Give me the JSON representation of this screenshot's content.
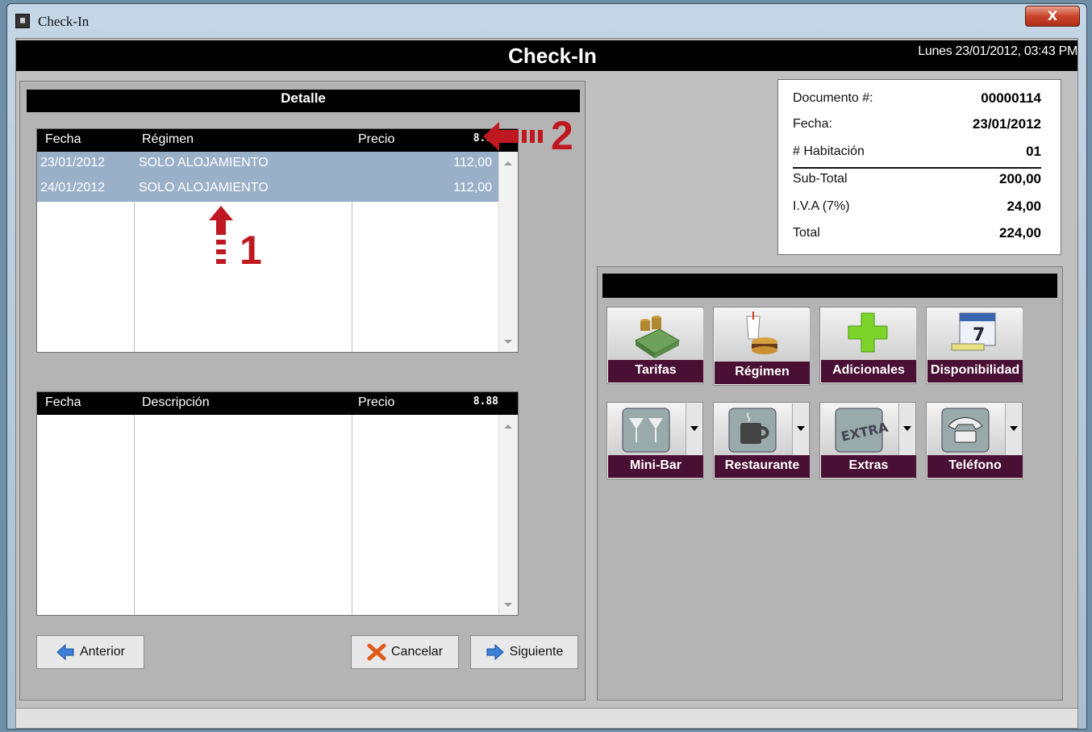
{
  "window": {
    "title": "Check-In",
    "close_label": "X"
  },
  "header": {
    "title": "Check-In",
    "datetime": "Lunes 23/01/2012, 03:43 PM"
  },
  "detalle": {
    "title": "Detalle",
    "columns": [
      "Fecha",
      "Régimen",
      "Precio"
    ],
    "rows": [
      {
        "fecha": "23/01/2012",
        "regimen": "SOLO ALOJAMIENTO",
        "precio": "112,00"
      },
      {
        "fecha": "24/01/2012",
        "regimen": "SOLO ALOJAMIENTO",
        "precio": "112,00"
      }
    ],
    "grid_icon": "8.88"
  },
  "extras_grid": {
    "columns": [
      "Fecha",
      "Descripción",
      "Precio"
    ],
    "grid_icon": "8.88"
  },
  "buttons": {
    "anterior": "Anterior",
    "cancelar": "Cancelar",
    "siguiente": "Siguiente"
  },
  "document": {
    "rows": [
      {
        "label": "Documento #:",
        "value": "00000114"
      },
      {
        "label": "Fecha:",
        "value": "23/01/2012"
      },
      {
        "label": "# Habitación",
        "value": "01"
      },
      {
        "label": "Sub-Total",
        "value": "200,00"
      },
      {
        "label": "I.V.A (7%)",
        "value": "24,00"
      },
      {
        "label": "Total",
        "value": "224,00"
      }
    ]
  },
  "tiles": {
    "tarifas": "Tarifas",
    "regimen": "Régimen",
    "adicionales": "Adicionales",
    "disponibilidad": "Disponibilidad",
    "minibar": "Mini-Bar",
    "restaurante": "Restaurante",
    "extras": "Extras",
    "telefono": "Teléfono"
  },
  "annotations": {
    "one": "1",
    "two": "2"
  },
  "colors": {
    "accent": "#4a0f34",
    "selection": "#9ab0c8",
    "annotation": "#c01820"
  }
}
